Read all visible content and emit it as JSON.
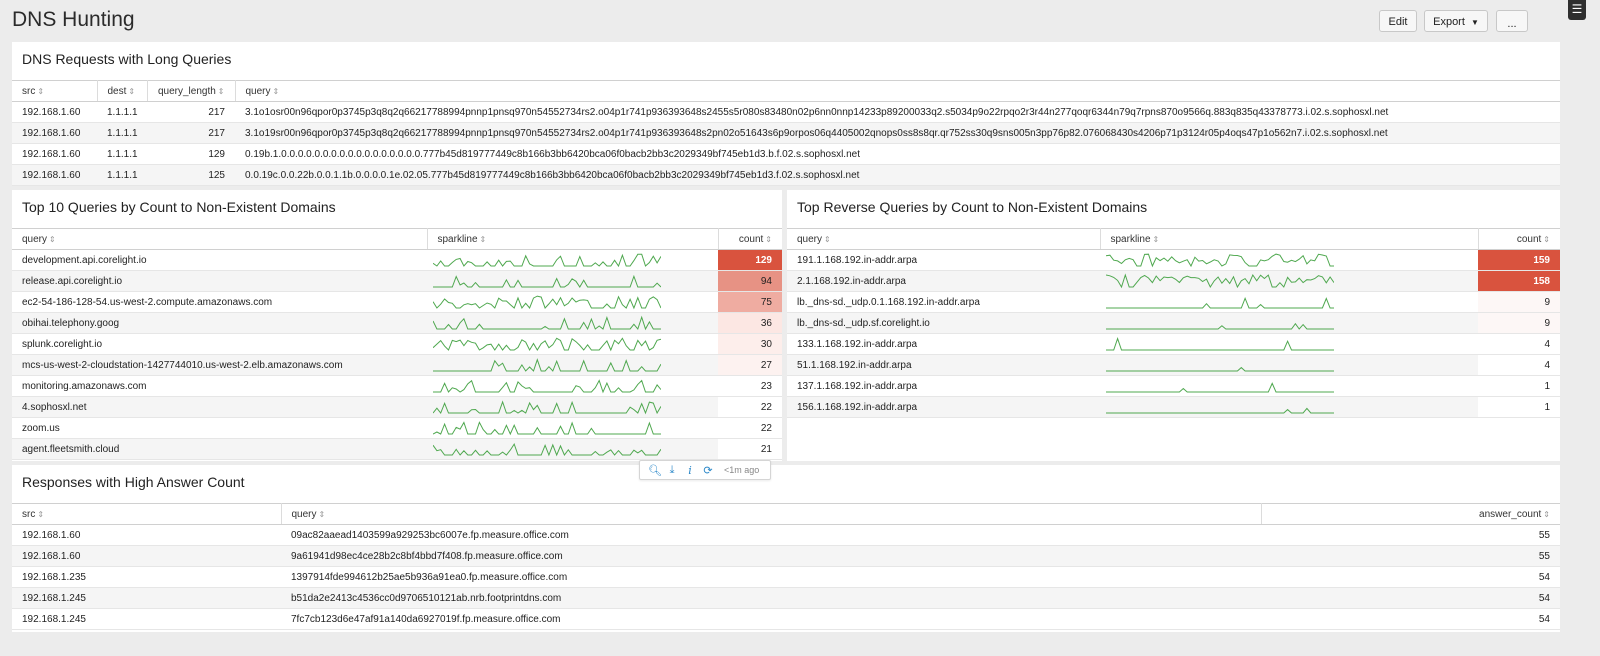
{
  "header": {
    "title": "DNS Hunting",
    "edit_label": "Edit",
    "export_label": "Export",
    "more_label": "...",
    "menu_icon": "hamburger-menu-icon"
  },
  "panel1": {
    "title": "DNS Requests with Long Queries",
    "columns": [
      "src",
      "dest",
      "query_length",
      "query"
    ],
    "rows": [
      [
        "192.168.1.60",
        "1.1.1.1",
        "217",
        "3.1o1osr00n96qpor0p3745p3q8q2q66217788994pnnp1pnsq970n54552734rs2.o04p1r741p936393648s2455s5r080s83480n02p6nn0nnp14233p89200033q2.s5034p9o22rpqo2r3r44n277qoqr6344n79q7rpns870o9566q.883q835q43378773.i.02.s.sophosxl.net"
      ],
      [
        "192.168.1.60",
        "1.1.1.1",
        "217",
        "3.1o19sr00n96qpor0p3745p3q8q2q66217788994pnnp1pnsq970n54552734rs2.o04p1r741p936393648s2pn02o51643s6p9orpos06q4405002qnops0ss8s8qr.qr752ss30q9sns005n3pp76p82.076068430s4206p71p3124r05p4oqs47p1o562n7.i.02.s.sophosxl.net"
      ],
      [
        "192.168.1.60",
        "1.1.1.1",
        "129",
        "0.19b.1.0.0.0.0.0.0.0.0.0.0.0.0.0.0.0.0.0.777b45d819777449c8b166b3bb6420bca06f0bacb2bb3c2029349bf745eb1d3.b.f.02.s.sophosxl.net"
      ],
      [
        "192.168.1.60",
        "1.1.1.1",
        "125",
        "0.0.19c.0.0.22b.0.0.1.1b.0.0.0.0.1e.02.05.777b45d819777449c8b166b3bb6420bca06f0bacb2bb3c2029349bf745eb1d3.f.02.s.sophosxl.net"
      ]
    ]
  },
  "panel2": {
    "title": "Top 10 Queries by Count to Non-Existent Domains",
    "columns": [
      "query",
      "sparkline",
      "count"
    ],
    "rows": [
      {
        "query": "development.api.corelight.io",
        "count": "129",
        "bg": "#d9533e",
        "fg": "#ffffff"
      },
      {
        "query": "release.api.corelight.io",
        "count": "94",
        "bg": "#e79284",
        "fg": "#1f1f1f"
      },
      {
        "query": "ec2-54-186-128-54.us-west-2.compute.amazonaws.com",
        "count": "75",
        "bg": "#efaca1",
        "fg": "#1f1f1f"
      },
      {
        "query": "obihai.telephony.goog",
        "count": "36",
        "bg": "#fce7e3",
        "fg": "#1f1f1f"
      },
      {
        "query": "splunk.corelight.io",
        "count": "30",
        "bg": "#fdeeeb",
        "fg": "#1f1f1f"
      },
      {
        "query": "mcs-us-west-2-cloudstation-1427744010.us-west-2.elb.amazonaws.com",
        "count": "27",
        "bg": "#fdf2f0",
        "fg": "#1f1f1f"
      },
      {
        "query": "monitoring.amazonaws.com",
        "count": "23",
        "bg": "#ffffff",
        "fg": "#1f1f1f"
      },
      {
        "query": "4.sophosxl.net",
        "count": "22",
        "bg": "#ffffff",
        "fg": "#1f1f1f"
      },
      {
        "query": "zoom.us",
        "count": "22",
        "bg": "#ffffff",
        "fg": "#1f1f1f"
      },
      {
        "query": "agent.fleetsmith.cloud",
        "count": "21",
        "bg": "#ffffff",
        "fg": "#1f1f1f"
      }
    ]
  },
  "panel3": {
    "title": "Top Reverse Queries by Count to Non-Existent Domains",
    "columns": [
      "query",
      "sparkline",
      "count"
    ],
    "rows": [
      {
        "query": "191.1.168.192.in-addr.arpa",
        "count": "159",
        "bg": "#d9533e",
        "fg": "#ffffff"
      },
      {
        "query": "2.1.168.192.in-addr.arpa",
        "count": "158",
        "bg": "#d9533e",
        "fg": "#ffffff"
      },
      {
        "query": "lb._dns-sd._udp.0.1.168.192.in-addr.arpa",
        "count": "9",
        "bg": "#fdf7f6",
        "fg": "#1f1f1f"
      },
      {
        "query": "lb._dns-sd._udp.sf.corelight.io",
        "count": "9",
        "bg": "#fdf7f6",
        "fg": "#1f1f1f"
      },
      {
        "query": "133.1.168.192.in-addr.arpa",
        "count": "4",
        "bg": "#ffffff",
        "fg": "#1f1f1f"
      },
      {
        "query": "51.1.168.192.in-addr.arpa",
        "count": "4",
        "bg": "#ffffff",
        "fg": "#1f1f1f"
      },
      {
        "query": "137.1.168.192.in-addr.arpa",
        "count": "1",
        "bg": "#ffffff",
        "fg": "#1f1f1f"
      },
      {
        "query": "156.1.168.192.in-addr.arpa",
        "count": "1",
        "bg": "#ffffff",
        "fg": "#1f1f1f"
      }
    ]
  },
  "panel4": {
    "title": "Responses with High Answer Count",
    "columns": [
      "src",
      "query",
      "answer_count"
    ],
    "rows": [
      [
        "192.168.1.60",
        "09ac82aaead1403599a929253bc6007e.fp.measure.office.com",
        "55"
      ],
      [
        "192.168.1.60",
        "9a61941d98ec4ce28b2c8bf4bbd7f408.fp.measure.office.com",
        "55"
      ],
      [
        "192.168.1.235",
        "1397914fde994612b25ae5b936a91ea0.fp.measure.office.com",
        "54"
      ],
      [
        "192.168.1.245",
        "b51da2e2413c4536cc0d9706510121ab.nrb.footprintdns.com",
        "54"
      ],
      [
        "192.168.1.245",
        "7fc7cb123d6e47af91a140da6927019f.fp.measure.office.com",
        "54"
      ]
    ]
  },
  "toolbar": {
    "icons": [
      "search-icon",
      "download-icon",
      "info-icon",
      "refresh-icon"
    ],
    "time_label": "<1m ago"
  },
  "colors": {
    "sparkline": "#4fa84f",
    "link_icon": "#2a87c8",
    "heat_high": "#d9533e"
  }
}
